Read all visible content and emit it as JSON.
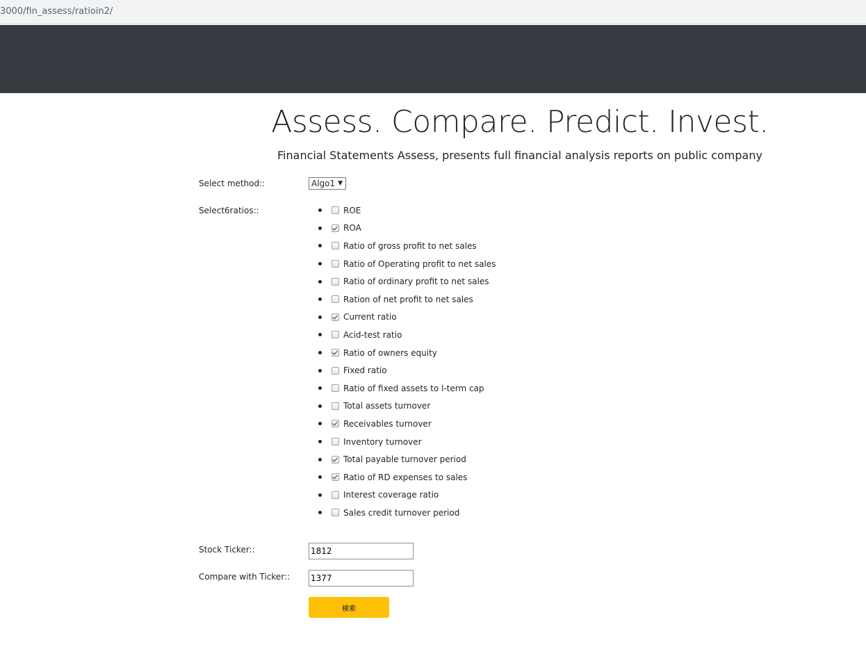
{
  "browser": {
    "url": "3000/fin_assess/ratioin2/"
  },
  "hero": {
    "title": "Assess. Compare. Predict. Invest.",
    "subtitle": "Financial Statements Assess, presents full financial analysis reports on public company"
  },
  "form": {
    "method_label": "Select method::",
    "method_value": "Algo1",
    "ratios_label": "Select6ratios::",
    "ratios": [
      {
        "label": "ROE",
        "checked": false
      },
      {
        "label": "ROA",
        "checked": true
      },
      {
        "label": "Ratio of gross profit to net sales",
        "checked": false
      },
      {
        "label": "Ratio of Operating profit to net sales",
        "checked": false
      },
      {
        "label": "Ratio of ordinary profit to net sales",
        "checked": false
      },
      {
        "label": "Ration of net profit to net sales",
        "checked": false
      },
      {
        "label": "Current ratio",
        "checked": true
      },
      {
        "label": "Acid-test ratio",
        "checked": false
      },
      {
        "label": "Ratio of owners equity",
        "checked": true
      },
      {
        "label": "Fixed ratio",
        "checked": false
      },
      {
        "label": "Ratio of fixed assets to l-term cap",
        "checked": false
      },
      {
        "label": "Total assets turnover",
        "checked": false
      },
      {
        "label": "Receivables turnover",
        "checked": true
      },
      {
        "label": "Inventory turnover",
        "checked": false
      },
      {
        "label": "Total payable turnover period",
        "checked": true
      },
      {
        "label": "Ratio of RD expenses to sales",
        "checked": true
      },
      {
        "label": "Interest coverage ratio",
        "checked": false
      },
      {
        "label": "Sales credit turnover period",
        "checked": false
      }
    ],
    "ticker_label": "Stock Ticker::",
    "ticker_value": "1812",
    "compare_label": "Compare with Ticker::",
    "compare_value": "1377",
    "submit_label": "検索"
  },
  "colors": {
    "navbar": "#343a40",
    "button": "#ffc107"
  }
}
